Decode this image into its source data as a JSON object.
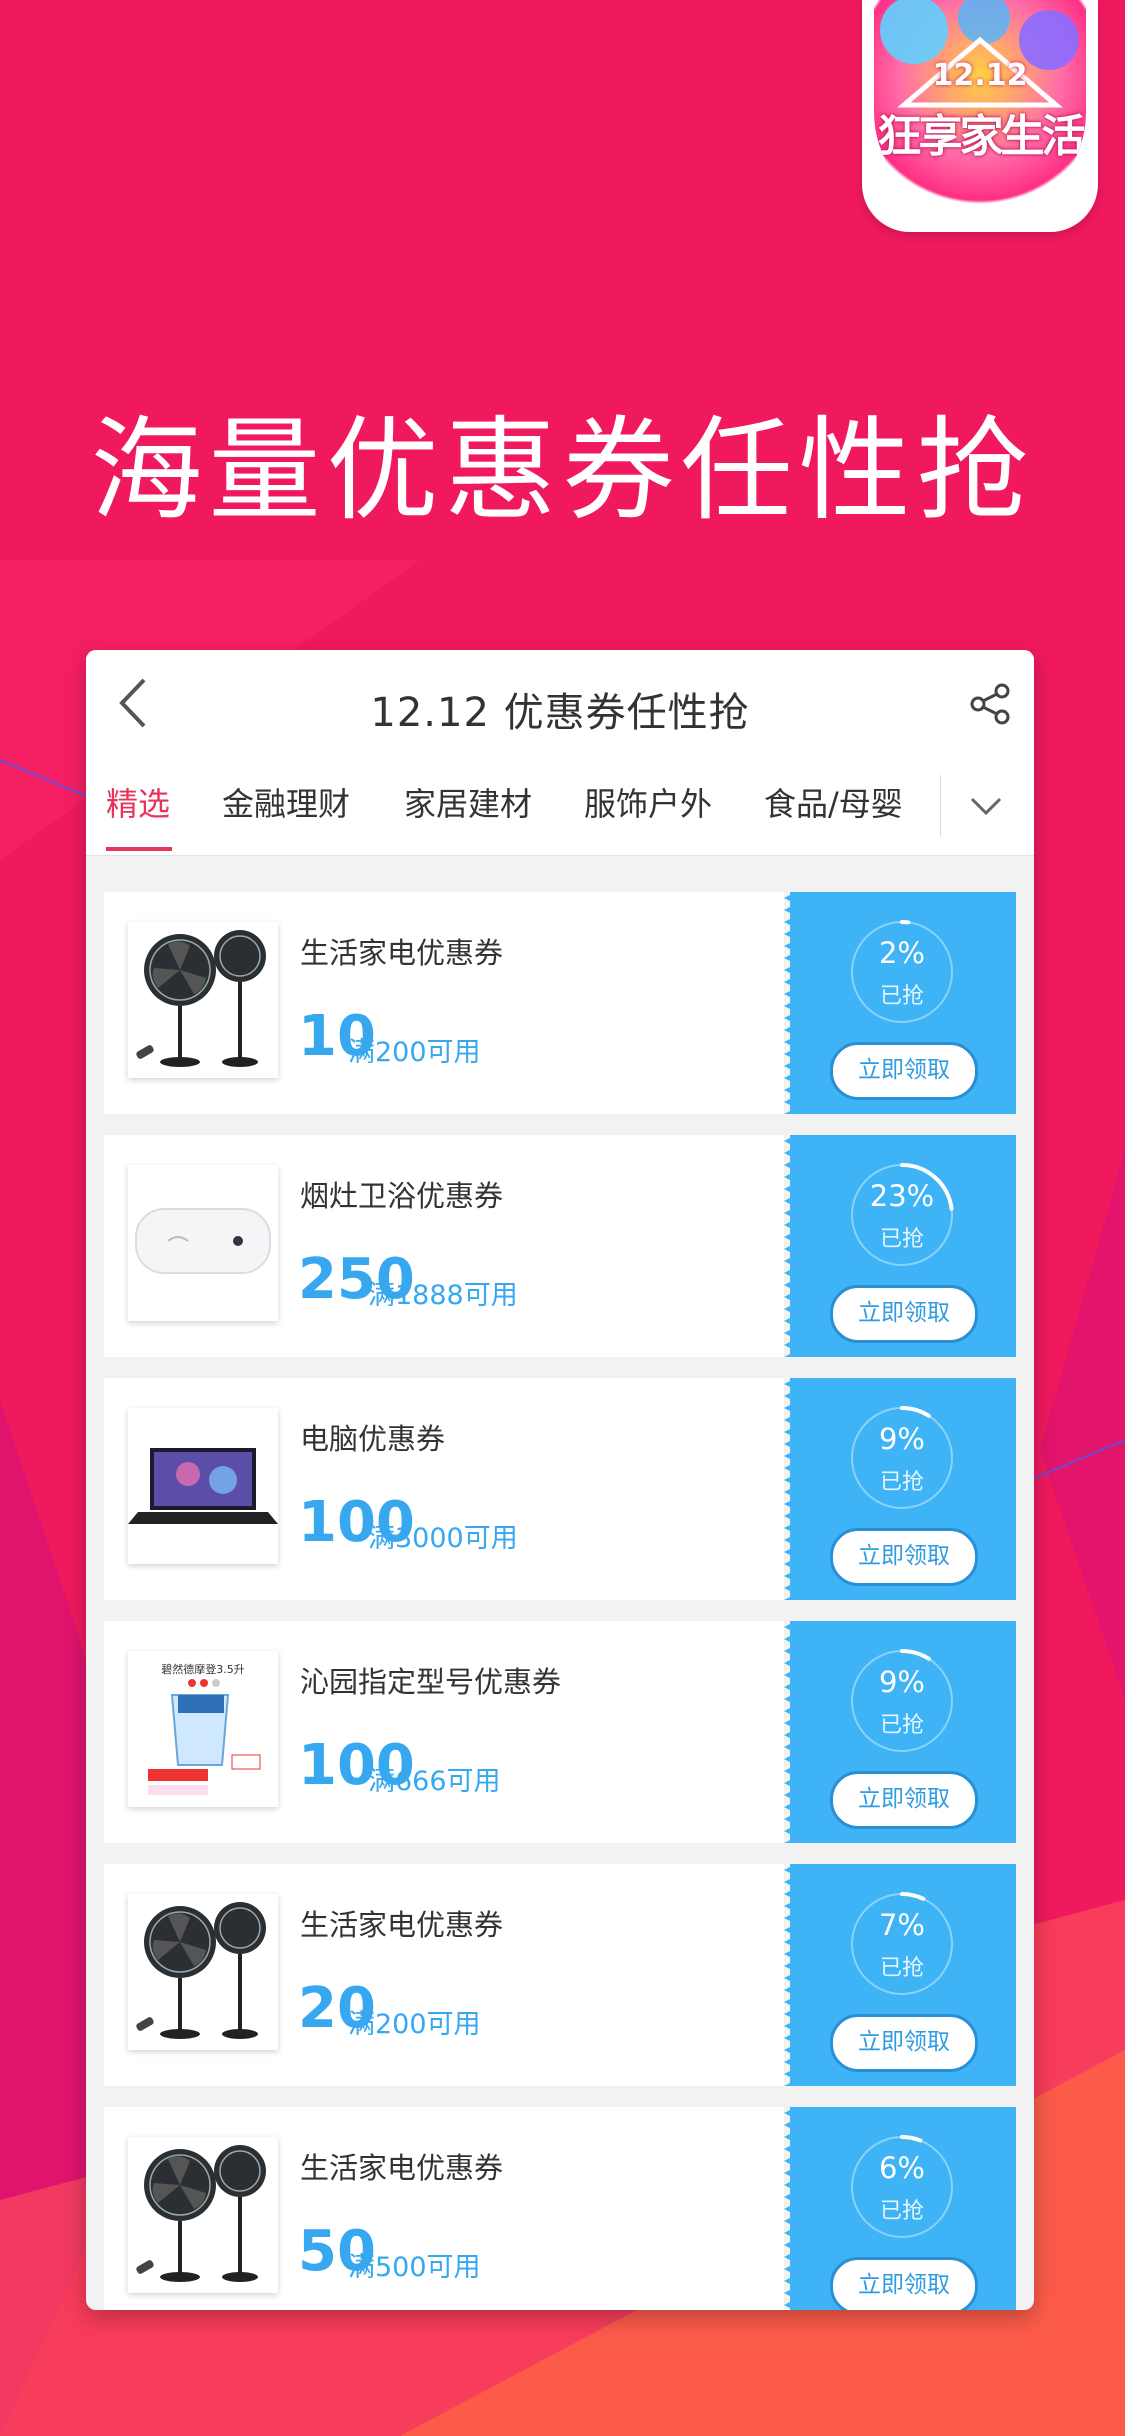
{
  "badge": {
    "year": "12.12",
    "title": "狂享家生活"
  },
  "hero_title": "海量优惠券任性抢",
  "nav": {
    "title": "12.12 优惠券任性抢"
  },
  "tabs": [
    "精选",
    "金融理财",
    "家居建材",
    "服饰户外",
    "食品/母婴"
  ],
  "active_tab": 0,
  "coupons": [
    {
      "title": "生活家电优惠券",
      "amount": "10",
      "condition": "满200可用",
      "percent_label": "2%",
      "percent": 2,
      "grabbed_label": "已抢",
      "button_label": "立即领取",
      "image": "fan-icon"
    },
    {
      "title": "烟灶卫浴优惠券",
      "amount": "250",
      "condition": "满1888可用",
      "percent_label": "23%",
      "percent": 23,
      "grabbed_label": "已抢",
      "button_label": "立即领取",
      "image": "water-heater-icon"
    },
    {
      "title": "电脑优惠券",
      "amount": "100",
      "condition": "满3000可用",
      "percent_label": "9%",
      "percent": 9,
      "grabbed_label": "已抢",
      "button_label": "立即领取",
      "image": "laptop-icon"
    },
    {
      "title": "沁园指定型号优惠券",
      "amount": "100",
      "condition": "满666可用",
      "percent_label": "9%",
      "percent": 9,
      "grabbed_label": "已抢",
      "button_label": "立即领取",
      "image": "water-pitcher-icon",
      "image_caption": "碧然德摩登3.5升"
    },
    {
      "title": "生活家电优惠券",
      "amount": "20",
      "condition": "满200可用",
      "percent_label": "7%",
      "percent": 7,
      "grabbed_label": "已抢",
      "button_label": "立即领取",
      "image": "fan-icon"
    },
    {
      "title": "生活家电优惠券",
      "amount": "50",
      "condition": "满500可用",
      "percent_label": "6%",
      "percent": 6,
      "grabbed_label": "已抢",
      "button_label": "立即领取",
      "image": "fan-icon"
    }
  ],
  "colors": {
    "background": "#f0195e",
    "accent_blue": "#3eb3f5",
    "tab_active": "#e8345a"
  }
}
